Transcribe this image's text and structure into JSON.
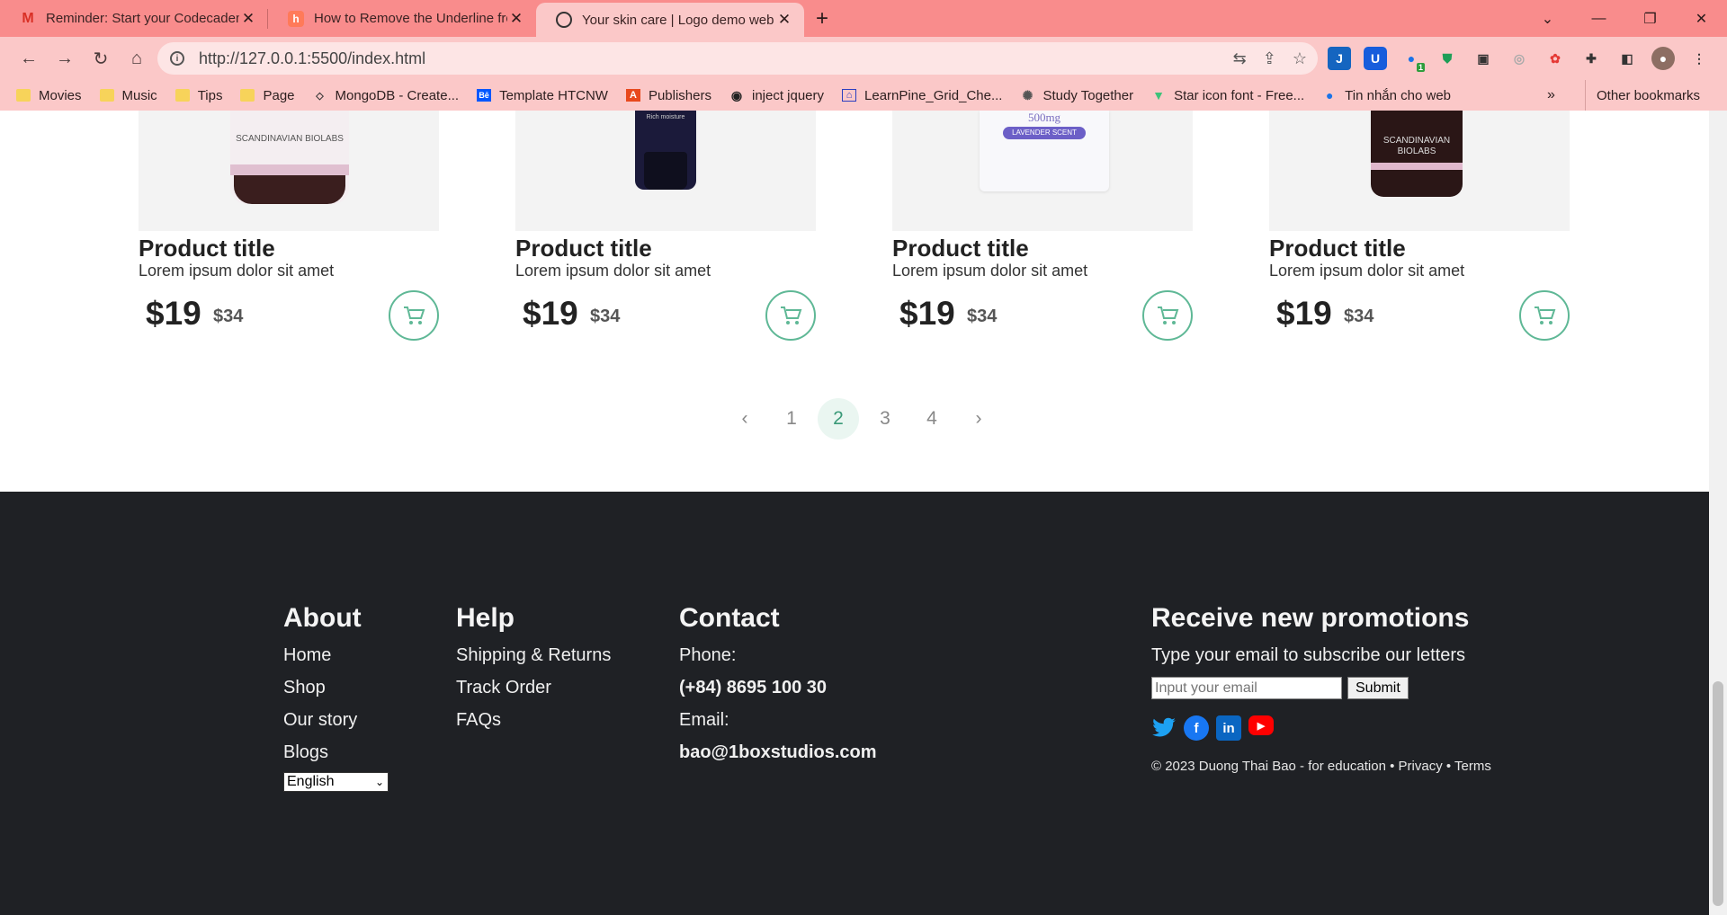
{
  "browser": {
    "tabs": [
      {
        "label": "Reminder: Start your Codecademy",
        "favicon": "gmail-icon",
        "active": false
      },
      {
        "label": "How to Remove the Underline fro",
        "favicon": "hubspot-icon",
        "active": false
      },
      {
        "label": "Your skin care | Logo demo web",
        "favicon": "globe-icon",
        "active": true
      }
    ],
    "url": "http://127.0.0.1:5500/index.html",
    "bookmarks": [
      "Movies",
      "Music",
      "Tips",
      "Page",
      "MongoDB - Create...",
      "Template HTCNW",
      "Publishers",
      "inject jquery",
      "LearnPine_Grid_Che...",
      "Study Together",
      "Star icon font - Free...",
      "Tin nhắn cho web"
    ],
    "more_bookmarks": "»",
    "other_bookmarks": "Other bookmarks",
    "extension_badge": "1"
  },
  "products": [
    {
      "title": "Product title",
      "desc": "Lorem ipsum dolor sit amet",
      "price": "$19",
      "old_price": "$34",
      "brand": "SCANDINAVIAN BIOLABS"
    },
    {
      "title": "Product title",
      "desc": "Lorem ipsum dolor sit amet",
      "price": "$19",
      "old_price": "$34",
      "brand": "Rich moisture"
    },
    {
      "title": "Product title",
      "desc": "Lorem ipsum dolor sit amet",
      "price": "$19",
      "old_price": "$34",
      "brand": "LAVENDER SCENT",
      "amount": "500mg"
    },
    {
      "title": "Product title",
      "desc": "Lorem ipsum dolor sit amet",
      "price": "$19",
      "old_price": "$34",
      "brand": "SCANDINAVIAN BIOLABS"
    }
  ],
  "pagination": {
    "prev": "‹",
    "pages": [
      "1",
      "2",
      "3",
      "4"
    ],
    "current": "2",
    "next": "›"
  },
  "footer": {
    "about": {
      "heading": "About",
      "links": [
        "Home",
        "Shop",
        "Our story",
        "Blogs"
      ],
      "language": "English"
    },
    "help": {
      "heading": "Help",
      "links": [
        "Shipping & Returns",
        "Track Order",
        "FAQs"
      ]
    },
    "contact": {
      "heading": "Contact",
      "phone_label": "Phone:",
      "phone": "(+84) 8695 100 30",
      "email_label": "Email:",
      "email": "bao@1boxstudios.com"
    },
    "promo": {
      "heading": "Receive new promotions",
      "text": "Type your email to subscribe our letters",
      "placeholder": "Input your email",
      "submit": "Submit",
      "copyright": "© 2023 Duong Thai Bao - for education • Privacy • Terms"
    }
  },
  "colors": {
    "accent": "#5fb896",
    "footer_bg": "#1f2125",
    "chrome": "#f98c8c"
  }
}
